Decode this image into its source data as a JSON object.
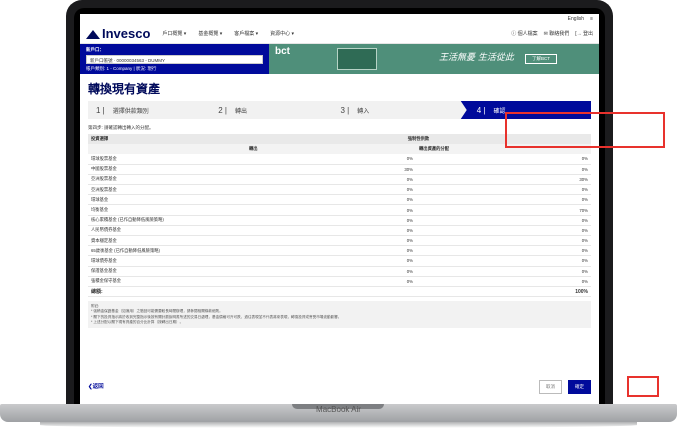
{
  "topbar": {
    "lang": "English",
    "menu_icon": "hamburger-icon"
  },
  "nav": {
    "logo": "Invesco",
    "items": [
      "戶口概覽 ▾",
      "基金概覽 ▾",
      "客戶檔案 ▾",
      "資源中心 ▾"
    ],
    "right": [
      "ⓘ 個人檔案",
      "✉ 聯絡我們",
      "[→ 登出"
    ]
  },
  "account": {
    "label": "新戶口：",
    "selected": "新戶口帳號 · 00000034563 - DUMMY",
    "detail": "帳戶類別: 1 - Company | 狀況: 現行"
  },
  "ad": {
    "brand": "bct",
    "slogan": "王活無憂 生活從此",
    "button": "了解BCT"
  },
  "page": {
    "title": "轉換現有資產"
  },
  "steps": [
    {
      "num": "1 |",
      "label": "選擇供款類別"
    },
    {
      "num": "2 |",
      "label": "轉出"
    },
    {
      "num": "3 |",
      "label": "轉入"
    },
    {
      "num": "4 |",
      "label": "確認"
    }
  ],
  "note": "第四步: 請確認轉出轉入的分配。",
  "table": {
    "col_fund": "投資選擇",
    "col_group": "強制性供款",
    "col_out": "轉出",
    "col_in": "轉出資產的分配",
    "rows": [
      {
        "name": "環球股票基金",
        "out": "0%",
        "in": "0%"
      },
      {
        "name": "中國股票基金",
        "out": "30%",
        "in": "0%"
      },
      {
        "name": "亞洲股票基金",
        "out": "0%",
        "in": "30%"
      },
      {
        "name": "亞洲股票基金",
        "out": "0%",
        "in": "0%"
      },
      {
        "name": "環球基金",
        "out": "0%",
        "in": "0%"
      },
      {
        "name": "均衡基金",
        "out": "0%",
        "in": "70%"
      },
      {
        "name": "核心累積基金 (已作自動降低風險策略)",
        "out": "0%",
        "in": "0%"
      },
      {
        "name": "人民幣債券基金",
        "out": "0%",
        "in": "0%"
      },
      {
        "name": "資本穩定基金",
        "out": "0%",
        "in": "0%"
      },
      {
        "name": "65歲後基金 (已作自動降低風險策略)",
        "out": "0%",
        "in": "0%"
      },
      {
        "name": "環球債券基金",
        "out": "0%",
        "in": "0%"
      },
      {
        "name": "保證基金基金",
        "out": "0%",
        "in": "0%"
      },
      {
        "name": "強積金保守基金",
        "out": "0%",
        "in": "0%"
      }
    ],
    "total_label": "總額:",
    "total_value": "100%"
  },
  "footnotes": [
    "附註:",
    "* 強積金保證基金（如適用）之贖回可能需要較長時間辦理，請參閱相關條款細則。",
    "* 閣下的投資指示將於收到完整指示後按有關計劃說明書所述的交易日處理，基金價格可升可跌，過往表現並不代表將來表現，轉換投資或會受市場波動影響。",
    "* 上述分配以閣下現有資產的百分比計算（按轉出日期）。"
  ],
  "actions": {
    "back": "❮返回",
    "cancel": "取消",
    "confirm": "確定"
  },
  "device": {
    "label": "MacBook Air"
  }
}
